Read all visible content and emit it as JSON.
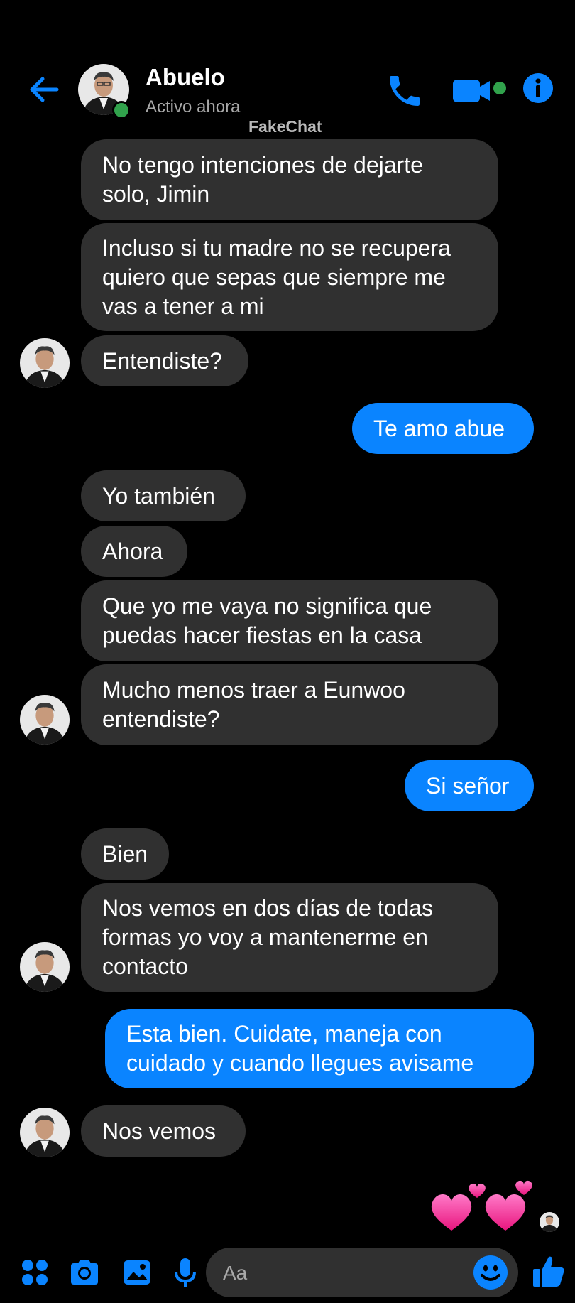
{
  "header": {
    "contact_name": "Abuelo",
    "status": "Activo ahora",
    "watermark": "FakeChat",
    "icons": [
      "back-arrow-icon",
      "phone-icon",
      "video-camera-icon",
      "info-icon"
    ],
    "accent_color": "#0a84ff"
  },
  "messages": [
    {
      "from": "them",
      "text": "No tengo intenciones de dejarte\nsolo, Jimin"
    },
    {
      "from": "them",
      "text": "Incluso si tu madre no se recupera\nquiero que sepas que siempre me\nvas a tener a mi"
    },
    {
      "from": "them",
      "text": "Entendiste?"
    },
    {
      "from": "me",
      "text": "Te amo abue"
    },
    {
      "from": "them",
      "text": "Yo también"
    },
    {
      "from": "them",
      "text": "Ahora"
    },
    {
      "from": "them",
      "text": "Que yo me vaya no significa que\npuedas hacer fiestas en la casa"
    },
    {
      "from": "them",
      "text": "Mucho menos traer a Eunwoo\nentendiste?"
    },
    {
      "from": "me",
      "text": "Si señor"
    },
    {
      "from": "them",
      "text": "Bien"
    },
    {
      "from": "them",
      "text": "Nos vemos en dos días de todas\nformas yo voy a mantenerme en\ncontacto"
    },
    {
      "from": "me",
      "text": "Esta bien. Cuidate, maneja con\ncuidado y cuando llegues avisame"
    },
    {
      "from": "them",
      "text": "Nos vemos"
    }
  ],
  "sticker": "two-hearts-emoji",
  "composer": {
    "placeholder": "Aa",
    "icons": [
      "apps-grid-icon",
      "camera-icon",
      "gallery-icon",
      "microphone-icon",
      "emoji-icon",
      "thumbs-up-icon"
    ]
  },
  "colors": {
    "background": "#000000",
    "incoming_bubble": "#303030",
    "outgoing_bubble": "#0a84ff",
    "online": "#31a24c"
  }
}
